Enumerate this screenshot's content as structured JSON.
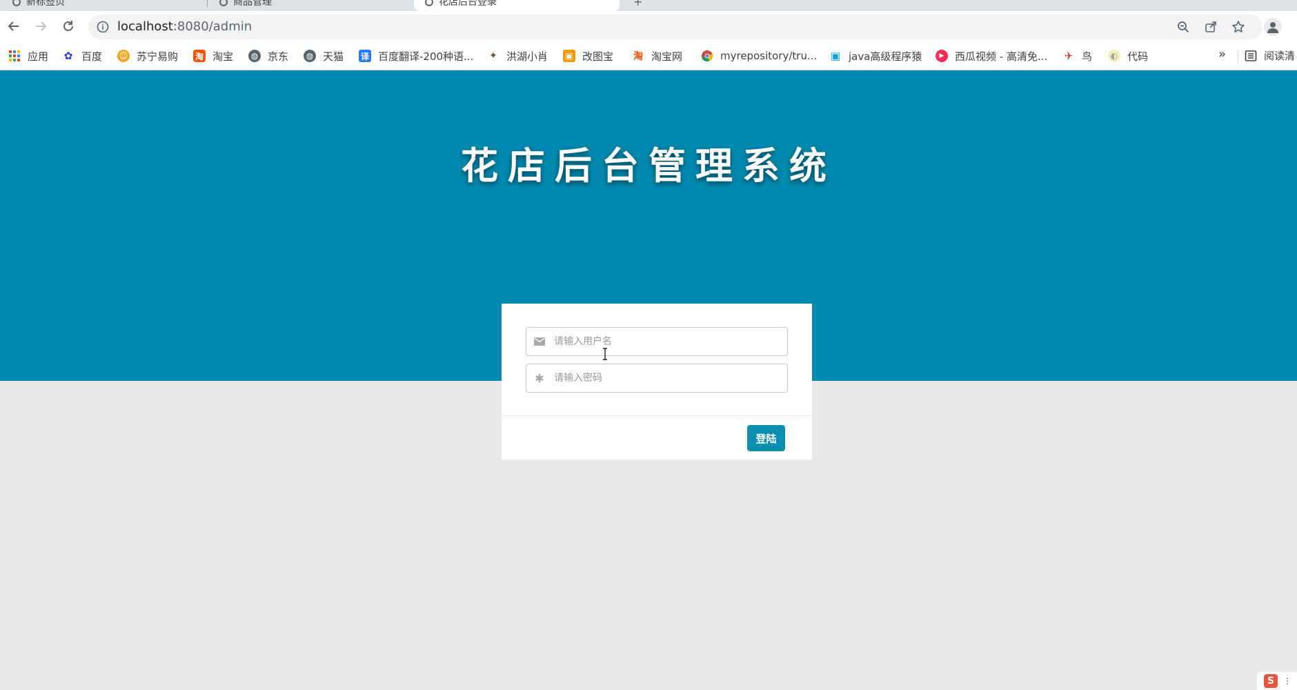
{
  "browser": {
    "tabs": [
      {
        "label": "新标签页"
      },
      {
        "label": "商品管理"
      },
      {
        "label": "花店后台登录"
      }
    ],
    "url_host": "localhost",
    "url_path": ":8080/admin"
  },
  "bookmarks": {
    "items": [
      {
        "label": "应用",
        "icon": "apps-grid-icon"
      },
      {
        "label": "百度",
        "icon": "baidu-paw-icon"
      },
      {
        "label": "苏宁易购",
        "icon": "suning-icon"
      },
      {
        "label": "淘宝",
        "icon": "taobao-icon"
      },
      {
        "label": "京东",
        "icon": "globe-icon"
      },
      {
        "label": "天猫",
        "icon": "globe-icon"
      },
      {
        "label": "百度翻译-200种语...",
        "icon": "translate-icon"
      },
      {
        "label": "洪湖小肖",
        "icon": "bird-icon"
      },
      {
        "label": "改图宝",
        "icon": "gaitubao-icon"
      },
      {
        "label": "淘宝网",
        "icon": "taobao-icon"
      },
      {
        "label": "myrepository/tru...",
        "icon": "chrome-icon"
      },
      {
        "label": "java高级程序猿",
        "icon": "bilibili-icon"
      },
      {
        "label": "西瓜视频 - 高清免...",
        "icon": "xigua-icon"
      },
      {
        "label": "鸟",
        "icon": "bird-icon"
      },
      {
        "label": "代码",
        "icon": "code-icon"
      }
    ],
    "overflow": "»",
    "reading_list": "阅读清"
  },
  "page": {
    "title": "花店后台管理系统",
    "username_placeholder": "请输入用户名",
    "password_placeholder": "请输入密码",
    "login_label": "登陆"
  },
  "colors": {
    "hero": "#008aaf",
    "button": "#0b8fb0",
    "background": "#e8e8e8"
  }
}
